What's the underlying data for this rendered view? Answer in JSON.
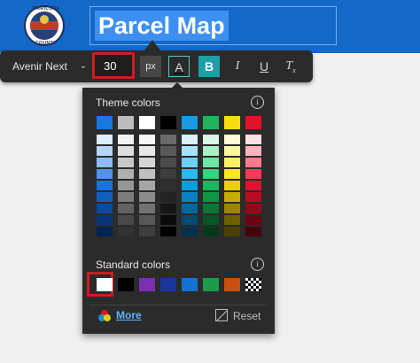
{
  "header": {
    "logo_text_top": "MARICOPA",
    "logo_text_bottom": "COUNTY",
    "title": "Parcel Map"
  },
  "toolbar": {
    "font_family": "Avenir Next",
    "font_size": "30",
    "unit": "px",
    "color_label": "A",
    "bold_label": "B",
    "italic_label": "I",
    "underline_label": "U",
    "clear_label": "T",
    "clear_sub": "x"
  },
  "popover": {
    "theme_label": "Theme colors",
    "standard_label": "Standard colors",
    "info_glyph": "i",
    "more_label": "More",
    "reset_label": "Reset"
  },
  "theme_colors": [
    [
      "#1877e0",
      "#bcbcbc",
      "#ffffff",
      "#000000",
      "#1a9ae0",
      "#22b45c",
      "#f7dd10",
      "#e0122c"
    ],
    [
      "#ddeeff",
      "#f2f2f2",
      "#f7f7f7",
      "#6a6a6a",
      "#d8f3ff",
      "#d7f8e6",
      "#fffbd6",
      "#ffe0e6"
    ],
    [
      "#b6d6fb",
      "#dedede",
      "#e8e8e8",
      "#5a5a5a",
      "#a8e3fb",
      "#a9f0c8",
      "#fff5a0",
      "#ffb3bf"
    ],
    [
      "#8dbcf4",
      "#c8c8c8",
      "#d6d6d6",
      "#4c4c4c",
      "#6dd0f6",
      "#6de6a4",
      "#ffef63",
      "#ff7a8e"
    ],
    [
      "#4f95ea",
      "#b0b0b0",
      "#c0c0c0",
      "#3e3e3e",
      "#2ab9ef",
      "#2fd67d",
      "#fde524",
      "#f63a55"
    ],
    [
      "#1a73de",
      "#969696",
      "#a6a6a6",
      "#303030",
      "#0a9ee0",
      "#18b85e",
      "#ebcf0a",
      "#e2112d"
    ],
    [
      "#115fc1",
      "#7c7c7c",
      "#8c8c8c",
      "#232323",
      "#0a82c0",
      "#119647",
      "#c6ac05",
      "#bc0c22"
    ],
    [
      "#0b4a9e",
      "#626262",
      "#727272",
      "#161616",
      "#07669a",
      "#0c7537",
      "#9a8504",
      "#950819"
    ],
    [
      "#073576",
      "#494949",
      "#585858",
      "#0a0a0a",
      "#044a72",
      "#075528",
      "#6f6002",
      "#6a0511"
    ],
    [
      "#042350",
      "#323232",
      "#3e3e3e",
      "#000000",
      "#02314d",
      "#04381a",
      "#4a4001",
      "#45030b"
    ]
  ],
  "standard_colors": [
    "#ffffff",
    "#000000",
    "#7a2fb0",
    "#1a35a0",
    "#1572d3",
    "#1e9b4a",
    "#c8500c",
    "checker"
  ]
}
